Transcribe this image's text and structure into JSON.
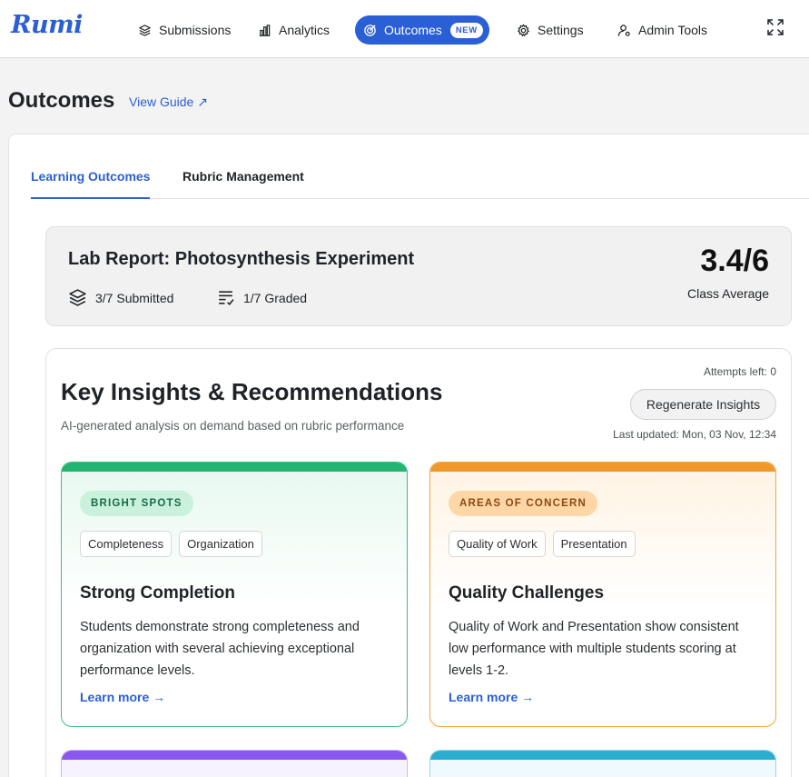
{
  "brand": {
    "logo": "Rumi",
    "accent": "#2a5fd6"
  },
  "nav": {
    "items": [
      {
        "label": "Submissions",
        "icon": "layers-icon"
      },
      {
        "label": "Analytics",
        "icon": "bar-chart-icon"
      },
      {
        "label": "Outcomes",
        "icon": "target-icon",
        "badge": "NEW",
        "active": true
      },
      {
        "label": "Settings",
        "icon": "gear-icon"
      },
      {
        "label": "Admin Tools",
        "icon": "user-gear-icon"
      }
    ],
    "expand_icon": "expand-icon"
  },
  "page": {
    "title": "Outcomes",
    "guide_link": "View Guide ↗"
  },
  "tabs": [
    {
      "label": "Learning Outcomes",
      "active": true
    },
    {
      "label": "Rubric Management",
      "active": false
    }
  ],
  "assignment": {
    "title": "Lab Report: Photosynthesis Experiment",
    "submitted": "3/7 Submitted",
    "graded": "1/7 Graded",
    "score": "3.4/6",
    "score_label": "Class Average"
  },
  "insights": {
    "title": "Key Insights & Recommendations",
    "subtitle": "AI-generated analysis on demand based on rubric performance",
    "attempts": "Attempts left: 0",
    "regenerate": "Regenerate Insights",
    "updated": "Last updated: Mon, 03 Nov, 12:34",
    "cards": [
      {
        "category": "BRIGHT SPOTS",
        "color": "#23b472",
        "tags": [
          "Completeness",
          "Organization"
        ],
        "title": "Strong Completion",
        "body": "Students demonstrate strong completeness and organization with several achieving exceptional performance levels.",
        "link": "Learn more →"
      },
      {
        "category": "AREAS OF CONCERN",
        "color": "#f0982a",
        "tags": [
          "Quality of Work",
          "Presentation"
        ],
        "title": "Quality Challenges",
        "body": "Quality of Work and Presentation show consistent low performance with multiple students scoring at levels 1-2.",
        "link": "Learn more →"
      }
    ]
  }
}
